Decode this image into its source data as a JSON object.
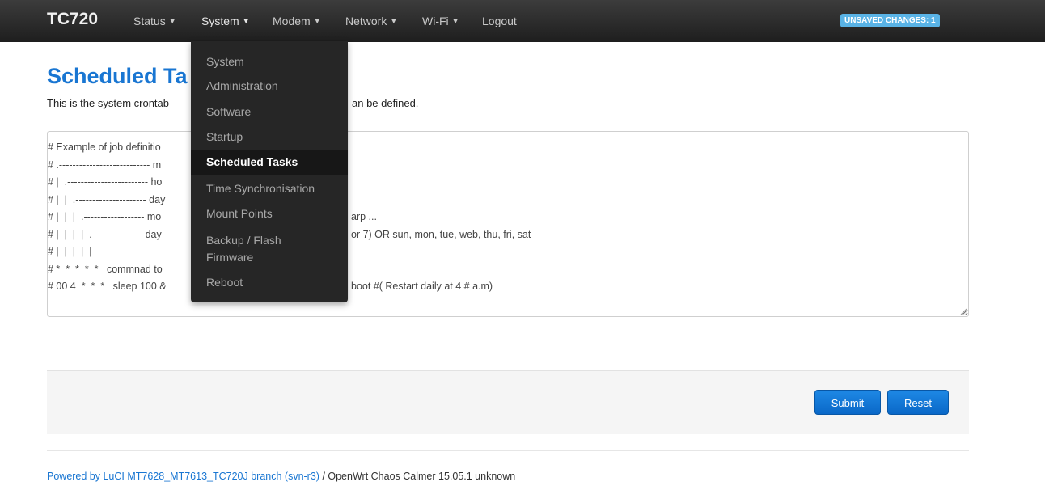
{
  "navbar": {
    "brand": "TC720",
    "menus": [
      {
        "label": "Status"
      },
      {
        "label": "System"
      },
      {
        "label": "Modem"
      },
      {
        "label": "Network"
      },
      {
        "label": "Wi-Fi"
      }
    ],
    "logout": "Logout",
    "unsaved_badge": "UNSAVED CHANGES: 1"
  },
  "dropdown": {
    "items": [
      {
        "label": "System"
      },
      {
        "label": "Administration"
      },
      {
        "label": "Software"
      },
      {
        "label": "Startup"
      },
      {
        "label": "Scheduled Tasks"
      },
      {
        "label": "Time Synchronisation"
      },
      {
        "label": "Mount Points"
      },
      {
        "label": "Backup / Flash Firmware"
      },
      {
        "label": "Reboot"
      }
    ]
  },
  "page": {
    "title_visible": "Scheduled Ta",
    "desc_left": "This is the system crontab",
    "desc_right": "an be defined."
  },
  "crontab": {
    "lines": [
      {
        "left": "# Example of job definitio",
        "right": ""
      },
      {
        "left": "# .--------------------------- m",
        "right": ""
      },
      {
        "left": "# |  .------------------------ ho",
        "right": ""
      },
      {
        "left": "# |  |  .--------------------- day",
        "right": ""
      },
      {
        "left": "# |  |  |  .------------------ mo",
        "right": "arp ..."
      },
      {
        "left": "# |  |  |  |  .--------------- day",
        "right": "or 7) OR sun, mon, tue, web, thu, fri, sat"
      },
      {
        "left": "# |  |  |  |  |",
        "right": ""
      },
      {
        "left": "# *  *  *  *  *   commnad to",
        "right": ""
      },
      {
        "left": "# 00 4  *  *  *   sleep 100 &",
        "right": "boot #( Restart daily at 4 # a.m)"
      }
    ]
  },
  "actions": {
    "submit": "Submit",
    "reset": "Reset"
  },
  "footer": {
    "powered_link": "Powered by LuCI MT7628_MT7613_TC720J branch (svn-r3)",
    "rest": " / OpenWrt Chaos Calmer 15.05.1 unknown"
  }
}
